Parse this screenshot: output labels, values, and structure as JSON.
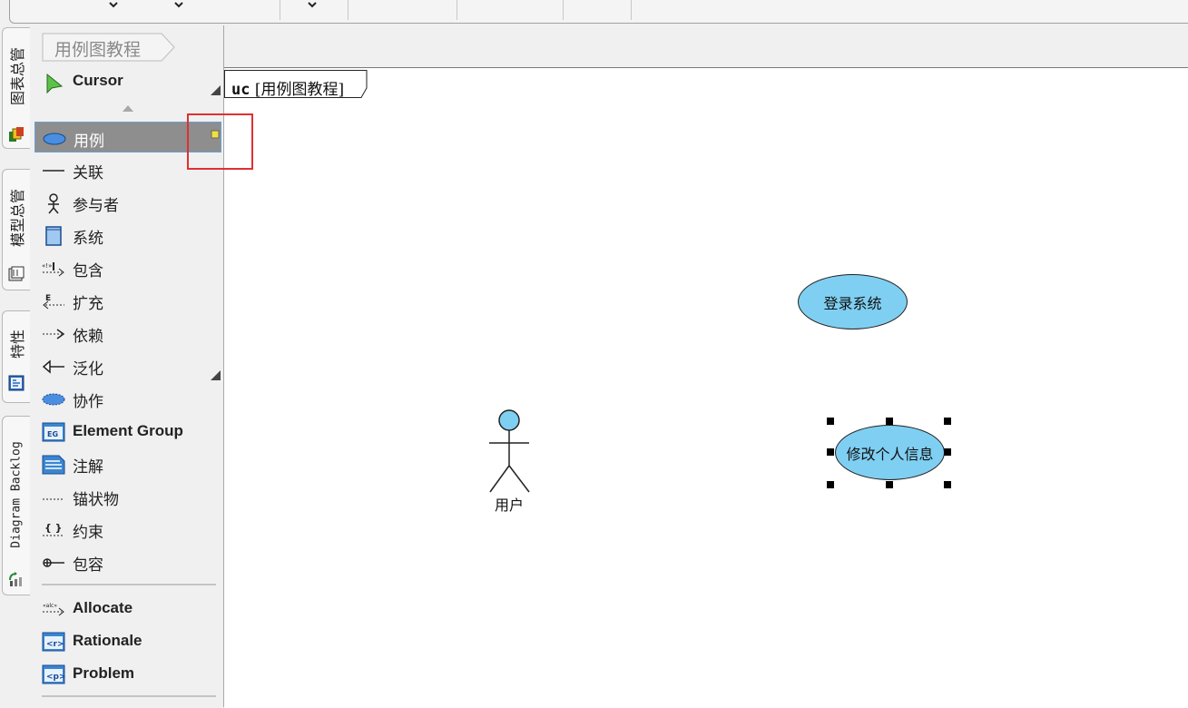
{
  "toolbar": {
    "chevron_icon": "chevron-down-icon"
  },
  "side_tabs": [
    {
      "label": "图表总管",
      "icon": "diagram-navigator-icon"
    },
    {
      "label": "模型总管",
      "icon": "model-explorer-icon"
    },
    {
      "label": "特性",
      "icon": "property-icon"
    },
    {
      "label": "Diagram Backlog",
      "icon": "diagram-backlog-icon"
    }
  ],
  "breadcrumb": {
    "label": "用例图教程"
  },
  "palette": {
    "cursor": "Cursor",
    "tools": [
      {
        "label": "用例",
        "icon": "use-case-icon",
        "selected": true
      },
      {
        "label": "关联",
        "icon": "association-icon"
      },
      {
        "label": "参与者",
        "icon": "actor-icon"
      },
      {
        "label": "系统",
        "icon": "system-icon"
      },
      {
        "label": "包含",
        "icon": "include-icon"
      },
      {
        "label": "扩充",
        "icon": "extend-icon"
      },
      {
        "label": "依赖",
        "icon": "dependency-icon"
      },
      {
        "label": "泛化",
        "icon": "generalization-icon"
      },
      {
        "label": "协作",
        "icon": "collaboration-icon"
      },
      {
        "label": "Element Group",
        "icon": "element-group-icon"
      },
      {
        "label": "注解",
        "icon": "note-icon"
      },
      {
        "label": "锚状物",
        "icon": "anchor-icon"
      },
      {
        "label": "约束",
        "icon": "constraint-icon"
      },
      {
        "label": "包容",
        "icon": "containment-icon"
      }
    ],
    "extra_tools": [
      {
        "label": "Allocate",
        "icon": "allocate-icon"
      },
      {
        "label": "Rationale",
        "icon": "rationale-icon"
      },
      {
        "label": "Problem",
        "icon": "problem-icon"
      }
    ]
  },
  "diagram": {
    "frame_kind": "uc",
    "frame_name": "[用例图教程]",
    "use_cases": [
      {
        "label": "登录系统",
        "selected": false
      },
      {
        "label": "修改个人信息",
        "selected": true
      }
    ],
    "actor": {
      "label": "用户"
    }
  },
  "colors": {
    "use_case_fill": "#7fcff2",
    "selected_tool_bg": "#8e8e8e",
    "highlight": "#e03030"
  }
}
